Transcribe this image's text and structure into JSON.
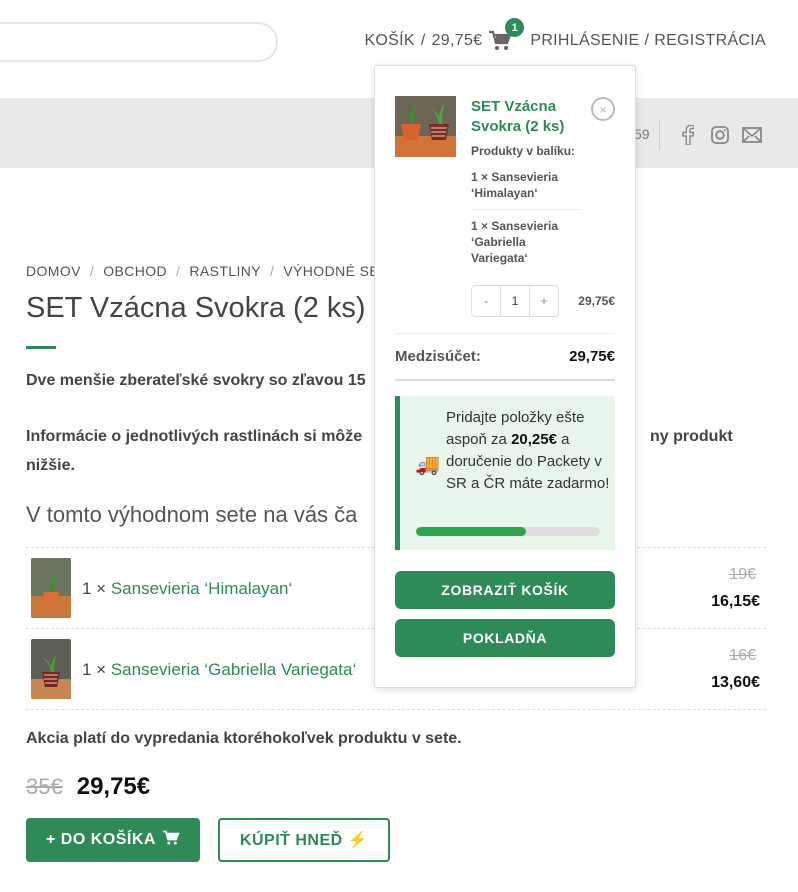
{
  "header": {
    "cart_label": "KOŠÍK",
    "cart_separator": "/",
    "cart_total": "29,75€",
    "cart_count": "1",
    "login": "PRIHLÁSENIE",
    "account_separator": "/",
    "register": "REGISTRÁCIA",
    "phone_partial": "59"
  },
  "breadcrumb": [
    "DOMOV",
    "OBCHOD",
    "RASTLINY",
    "VÝHODNÉ SET"
  ],
  "product": {
    "title": "SET Vzácna Svokra (2 ks)",
    "desc_line1": "Dve menšie zberateľské svokry so zľavou 15",
    "desc_line2a": "Informácie o jednotlivých rastlinách si môže",
    "desc_line2b": "ny produkt",
    "desc_line2c": "nižšie.",
    "subheading": "V tomto výhodnom sete na vás ča",
    "items": [
      {
        "qty": "1 ×",
        "name": "Sansevieria ‘Himalayan‘",
        "old_price": "19€",
        "new_price": "16,15€"
      },
      {
        "qty": "1 ×",
        "name": "Sansevieria ‘Gabriella Variegata‘",
        "old_price": "16€",
        "new_price": "13,60€"
      }
    ],
    "promo_note": "Akcia platí do vypredania ktoréhokoľvek produktu v sete.",
    "price_old": "35€",
    "price_new": "29,75€",
    "add_to_cart": "+ DO KOŠÍKA",
    "buy_now": "KÚPIŤ HNEĎ ⚡"
  },
  "minicart": {
    "item_title": "SET Vzácna Svokra (2 ks)",
    "remove_symbol": "×",
    "bundle_label": "Produkty v balíku:",
    "bundle_items": [
      "1 × Sansevieria ‘Himalayan‘",
      "1 × Sansevieria ‘Gabriella Variegata‘"
    ],
    "qty_minus": "-",
    "qty_value": "1",
    "qty_plus": "+",
    "line_price": "29,75€",
    "subtotal_label": "Medzisúčet:",
    "subtotal_value": "29,75€",
    "free_shipping": {
      "icon": "🚚",
      "text_before": "Pridajte položky ešte aspoň za",
      "amount": "20,25€",
      "text_after": "a doručenie do Packety v SR a ČR máte zadarmo!",
      "progress": 0.6
    },
    "view_cart": "ZOBRAZIŤ KOŠÍK",
    "checkout": "POKLADŇA"
  },
  "colors": {
    "accent": "#2e8b57",
    "progress": "#2ea44f",
    "free_bg": "#e8f6ec"
  }
}
